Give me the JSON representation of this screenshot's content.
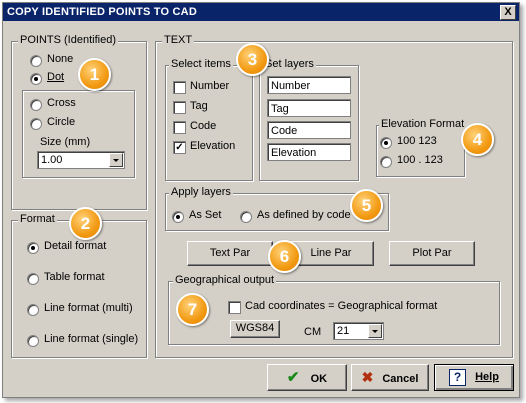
{
  "window": {
    "title": "COPY IDENTIFIED POINTS TO CAD",
    "close_label": "X"
  },
  "points": {
    "group_label": "POINTS (Identified)",
    "none_label": "None",
    "dot_label": "Dot",
    "cross_label": "Cross",
    "circle_label": "Circle",
    "size_label": "Size (mm)",
    "size_value": "1.00",
    "selected": "Dot"
  },
  "format": {
    "group_label": "Format",
    "options": [
      "Detail format",
      "Table format",
      "Line format (multi)",
      "Line format (single)"
    ],
    "selected": "Detail format"
  },
  "text": {
    "group_label": "TEXT",
    "select_items": {
      "label": "Select items",
      "number": "Number",
      "tag": "Tag",
      "code": "Code",
      "elevation": "Elevation",
      "checked": [
        "Elevation"
      ]
    },
    "set_layers": {
      "label": "Set layers",
      "values": [
        "Number",
        "Tag",
        "Code",
        "Elevation"
      ]
    },
    "elevation_format": {
      "label": "Elevation Format",
      "opt1": "100 123",
      "opt2": "100 . 123",
      "selected": "100 123"
    },
    "apply_layers": {
      "label": "Apply layers",
      "as_set": "As Set",
      "as_defined": "As defined by code",
      "selected": "As Set"
    },
    "buttons": {
      "text_par": "Text Par",
      "line_par": "Line Par",
      "plot_par": "Plot Par"
    },
    "geo": {
      "label": "Geographical output",
      "cad_coords": "Cad coordinates = Geographical format",
      "wgs84": "WGS84",
      "cm_label": "CM",
      "cm_value": "21"
    }
  },
  "footer": {
    "ok": "OK",
    "cancel": "Cancel",
    "help": "Help"
  },
  "badges": [
    "1",
    "2",
    "3",
    "4",
    "5",
    "6",
    "7"
  ]
}
